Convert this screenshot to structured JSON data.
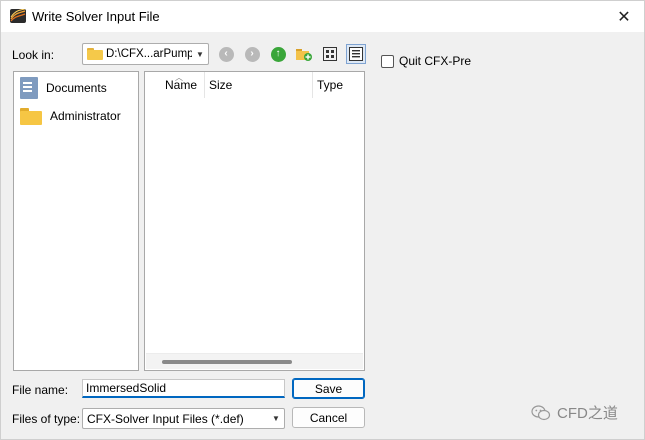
{
  "window": {
    "title": "Write Solver Input File",
    "close_glyph": "✕"
  },
  "toolbar": {
    "look_in_label": "Look in:",
    "look_in_value": "D:\\CFX...arPump",
    "icons": [
      "back-icon",
      "forward-icon",
      "up-folder-icon",
      "new-folder-icon",
      "list-view-icon",
      "detail-view-icon"
    ]
  },
  "places": {
    "items": [
      {
        "label": "Documents",
        "icon": "documents-icon"
      },
      {
        "label": "Administrator",
        "icon": "folder-icon"
      }
    ]
  },
  "file_list": {
    "columns": [
      "Name",
      "Size",
      "Type"
    ],
    "sort_column": "Name"
  },
  "options": {
    "quit_label": "Quit CFX-Pre",
    "quit_checked": false
  },
  "form": {
    "file_name_label": "File name:",
    "file_name_value": "ImmersedSolid",
    "file_type_label": "Files of type:",
    "file_type_value": "CFX-Solver Input Files (*.def)"
  },
  "buttons": {
    "save": "Save",
    "cancel": "Cancel"
  },
  "watermark": {
    "text": "CFD之道"
  },
  "colors": {
    "accent": "#0067c0",
    "folder": "#f5c94a",
    "up_arrow": "#3aa63a"
  }
}
